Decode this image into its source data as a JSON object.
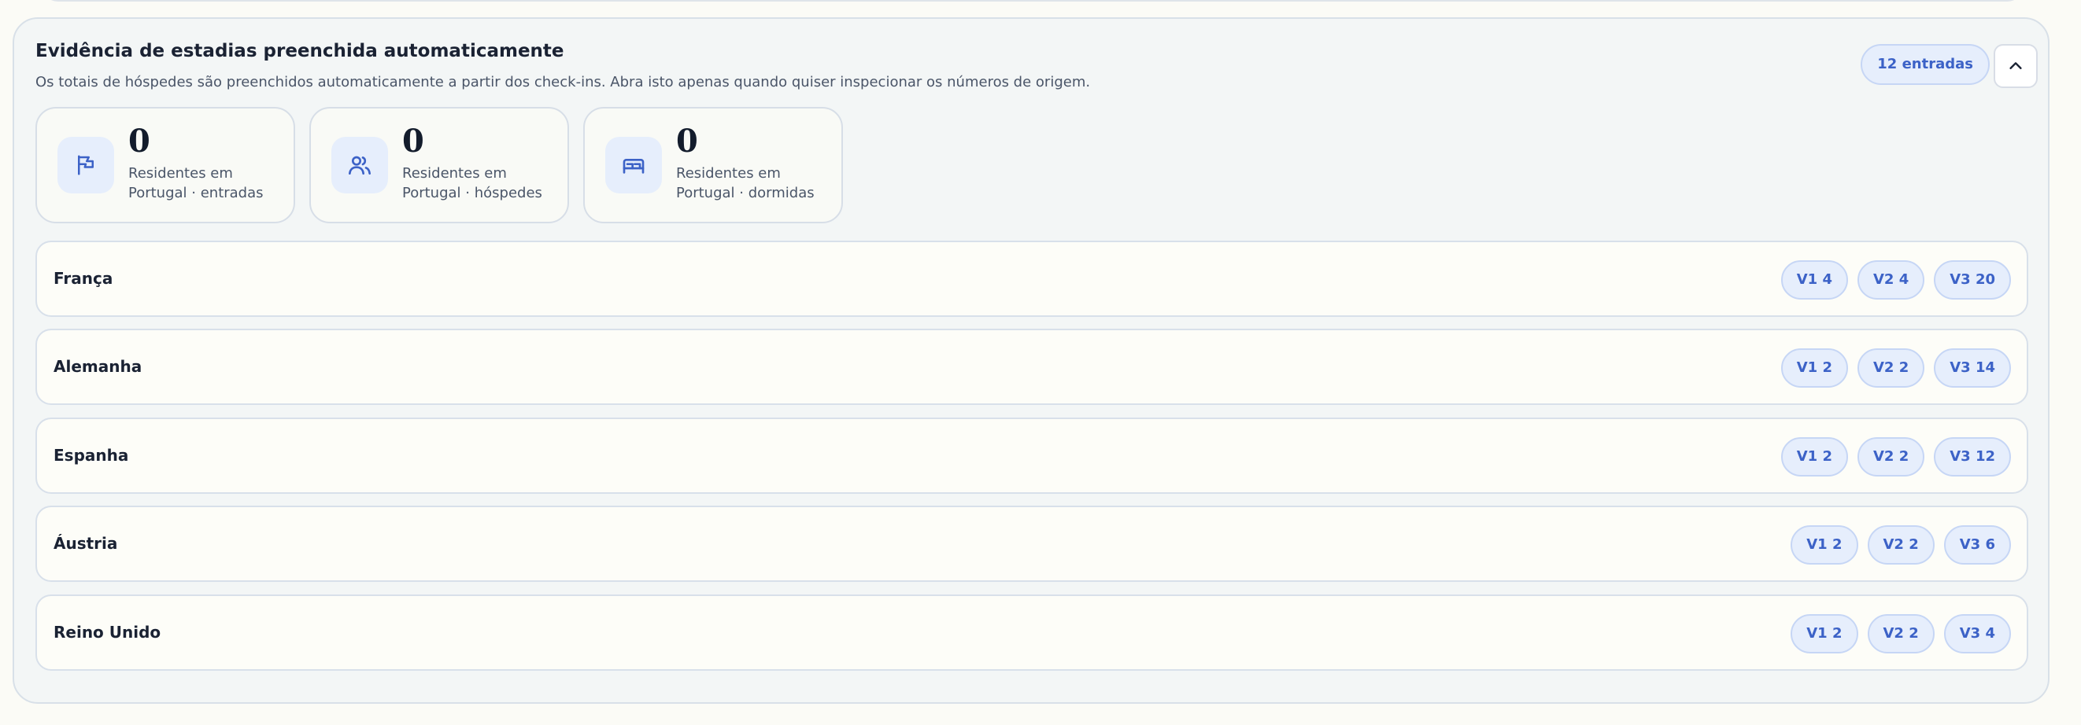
{
  "panel": {
    "title": "Evidência de estadias preenchida automaticamente",
    "subtitle": "Os totais de hóspedes são preenchidos automaticamente a partir dos check-ins. Abra isto apenas quando quiser inspecionar os números de origem.",
    "entries_badge": "12 entradas",
    "collapse_icon": "chevron-up-icon"
  },
  "stats": [
    {
      "icon": "flag-icon",
      "value": "0",
      "label": "Residentes em Portugal · entradas"
    },
    {
      "icon": "users-icon",
      "value": "0",
      "label": "Residentes em Portugal · hóspedes"
    },
    {
      "icon": "bed-icon",
      "value": "0",
      "label": "Residentes em Portugal · dormidas"
    }
  ],
  "countries": [
    {
      "name": "França",
      "chips": [
        "V1 4",
        "V2 4",
        "V3 20"
      ]
    },
    {
      "name": "Alemanha",
      "chips": [
        "V1 2",
        "V2 2",
        "V3 14"
      ]
    },
    {
      "name": "Espanha",
      "chips": [
        "V1 2",
        "V2 2",
        "V3 12"
      ]
    },
    {
      "name": "Áustria",
      "chips": [
        "V1 2",
        "V2 2",
        "V3 6"
      ]
    },
    {
      "name": "Reino Unido",
      "chips": [
        "V1 2",
        "V2 2",
        "V3 4"
      ]
    }
  ],
  "colors": {
    "accent": "#3c62c7",
    "chip_bg": "#e6eefc",
    "panel_bg": "#f3f6f6"
  }
}
